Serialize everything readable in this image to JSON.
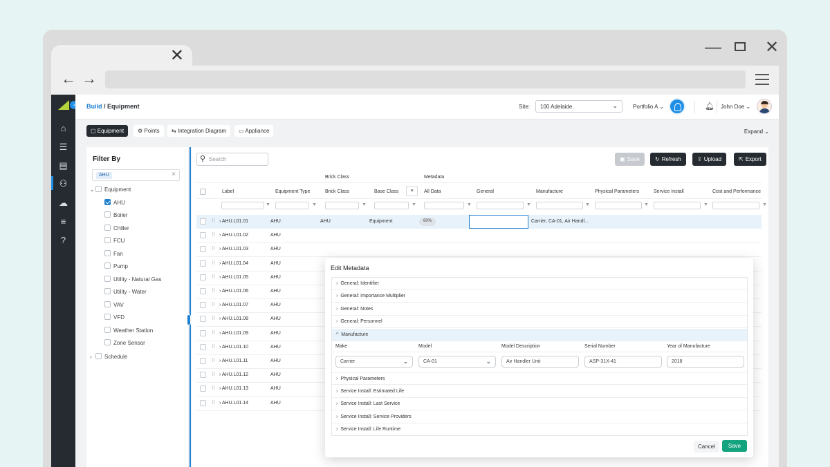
{
  "app": {
    "breadcrumb_link": "Build",
    "breadcrumb_sep": " / ",
    "breadcrumb_current": "Equipment",
    "site_label": "Site:",
    "site_value": "100 Adelaide",
    "portfolio": "Portfolio A",
    "user_name": "John Doe",
    "expand_label": "Expand"
  },
  "tabs": [
    {
      "label": "Equipment",
      "icon": "box-icon"
    },
    {
      "label": "Points",
      "icon": "gear-icon"
    },
    {
      "label": "Integration Diagram",
      "icon": "flow-icon"
    },
    {
      "label": "Appliance",
      "icon": "appliance-icon"
    }
  ],
  "filter": {
    "title": "Filter By",
    "chip": "AHU",
    "items": [
      "Equipment",
      "AHU",
      "Boiler",
      "Chiller",
      "FCU",
      "Fan",
      "Pump",
      "Utility - Natural Gas",
      "Utility - Water",
      "VAV",
      "VFD",
      "Weather Station",
      "Zone Sensor",
      "Schedule"
    ]
  },
  "toolbar": {
    "search_placeholder": "Search",
    "save": "Save",
    "refresh": "Refresh",
    "upload": "Upload",
    "export": "Export"
  },
  "table": {
    "group_brick": "Brick Class",
    "group_metadata": "Metadata",
    "headers": [
      "Label",
      "Equipment Type",
      "Brick Class",
      "Base Class",
      "All Data",
      "General",
      "Manufacture",
      "Physical Parameters",
      "Service Install",
      "Cost and Performance"
    ],
    "rows": [
      {
        "label": "AHU.L01.01",
        "type": "AHU",
        "brick": "AHU",
        "base": "Equipment",
        "all": "60%",
        "manufacture": "Carrier, CA-01, Air Handl..."
      },
      {
        "label": "AHU.L01.02",
        "type": "AHU"
      },
      {
        "label": "AHU.L01.03",
        "type": "AHU"
      },
      {
        "label": "AHU.L01.04",
        "type": "AHU"
      },
      {
        "label": "AHU.L01.05",
        "type": "AHU"
      },
      {
        "label": "AHU.L01.06",
        "type": "AHU"
      },
      {
        "label": "AHU.L01.07",
        "type": "AHU"
      },
      {
        "label": "AHU.L01.08",
        "type": "AHU"
      },
      {
        "label": "AHU.L01.09",
        "type": "AHU"
      },
      {
        "label": "AHU.L01.10",
        "type": "AHU"
      },
      {
        "label": "AHU.L01.11",
        "type": "AHU"
      },
      {
        "label": "AHU.L01.12",
        "type": "AHU"
      },
      {
        "label": "AHU.L01.13",
        "type": "AHU"
      },
      {
        "label": "AHU.L01.14",
        "type": "AHU"
      }
    ]
  },
  "modal": {
    "title": "Edit Metadata",
    "sections_before": [
      "General: Identifier",
      "General: Importance Multiplier",
      "General: Notes",
      "General: Personnel"
    ],
    "open_section": "Manufacture",
    "field_labels": [
      "Make",
      "Model",
      "Model Description",
      "Serial Number",
      "Year of Manufacture"
    ],
    "field_values": [
      "Carrier",
      "CA-01",
      "Air Handler Unit",
      "ASP-31X-41",
      "2018"
    ],
    "sections_after": [
      "Physical Parameters",
      "Service Install: Estimated Life",
      "Service Install: Last Service",
      "Service Install: Service Providers",
      "Service Install: Life Runtime"
    ],
    "cancel": "Cancel",
    "save": "Save"
  }
}
